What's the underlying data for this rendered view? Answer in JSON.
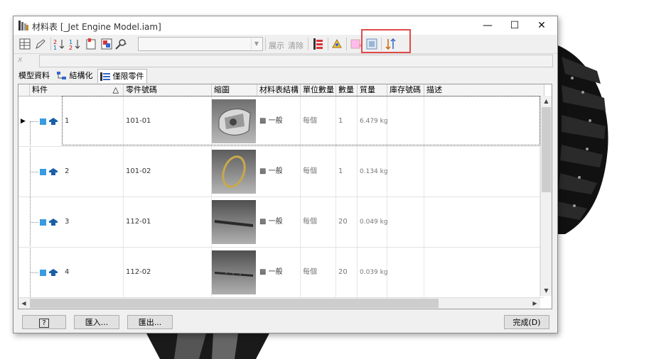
{
  "window": {
    "title": "材料表 [_Jet Engine Model.iam]",
    "controls": [
      "minimize-icon",
      "maximize-icon",
      "close-icon"
    ]
  },
  "toolbar": {
    "view_combo_value": "",
    "show_label": "展示",
    "clear_label": "清除",
    "highlight_color": "#e04a4a"
  },
  "formula_bar": {
    "icon_text": "x",
    "value": ""
  },
  "tabs": [
    {
      "label": "模型資料",
      "active": false
    },
    {
      "label": "結構化",
      "active": false
    },
    {
      "label": "僅限零件",
      "active": true
    }
  ],
  "table": {
    "columns": [
      "料件",
      "零件號碼",
      "縮圖",
      "材料表結構",
      "單位數量",
      "數量",
      "質量",
      "庫存號碼",
      "描述"
    ],
    "sort_indicator": "△",
    "rows": [
      {
        "item": "1",
        "part_number": "101-01",
        "structure": "一般",
        "unit_qty": "每個",
        "qty": "1",
        "mass": "6.479 kg",
        "thumb": "engine-casing-thumbnail"
      },
      {
        "item": "2",
        "part_number": "101-02",
        "structure": "一般",
        "unit_qty": "每個",
        "qty": "1",
        "mass": "0.134 kg",
        "thumb": "ring-thumbnail"
      },
      {
        "item": "3",
        "part_number": "112-01",
        "structure": "一般",
        "unit_qty": "每個",
        "qty": "20",
        "mass": "0.049 kg",
        "thumb": "blade-thumbnail"
      },
      {
        "item": "4",
        "part_number": "112-02",
        "structure": "一般",
        "unit_qty": "每個",
        "qty": "20",
        "mass": "0.039 kg",
        "thumb": "blade-thumbnail"
      }
    ]
  },
  "buttons": {
    "help": "?",
    "import": "匯入...",
    "export": "匯出...",
    "done": "完成(D)"
  }
}
